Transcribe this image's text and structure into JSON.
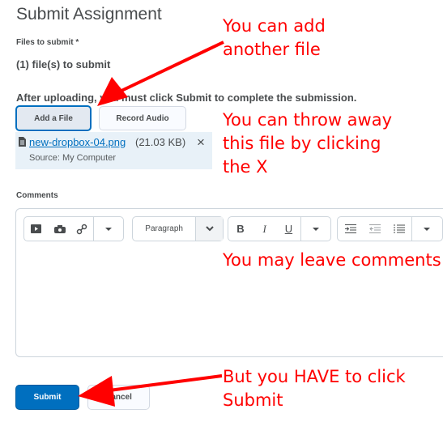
{
  "page": {
    "title": "Submit Assignment",
    "files_label": "Files to submit *",
    "files_count": "(1) file(s) to submit",
    "instruction": "After uploading, you must click Submit to complete the submission."
  },
  "buttons": {
    "add_file": "Add a File",
    "record_audio": "Record Audio",
    "submit": "Submit",
    "cancel": "Cancel"
  },
  "file": {
    "name": "new-dropbox-04.png",
    "size": "(21.03 KB)",
    "source": "Source: My Computer",
    "remove_icon": "×"
  },
  "comments": {
    "label": "Comments",
    "format_select": "Paragraph",
    "toolbar": {
      "bold": "B",
      "italic": "I",
      "underline": "U"
    }
  },
  "annotations": {
    "add_file": [
      "You can add",
      "another file"
    ],
    "remove_file": [
      "You can throw away",
      "this file by clicking",
      "the X"
    ],
    "comments": [
      "You may leave comments"
    ],
    "submit": [
      "But you HAVE to click",
      "Submit"
    ]
  },
  "colors": {
    "accent": "#006fbf",
    "annotation": "#ff0000",
    "text": "#494c4e"
  }
}
